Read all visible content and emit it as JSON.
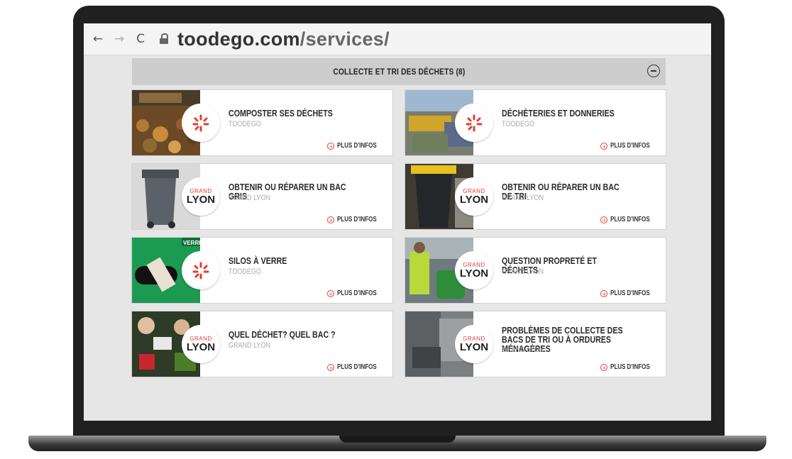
{
  "browser": {
    "url_domain": "toodego.com",
    "url_path": "/services/",
    "back_icon": "arrow-left",
    "forward_icon": "arrow-right",
    "reload_icon": "reload"
  },
  "section": {
    "title": "COLLECTE ET TRI DES DÉCHETS (8)",
    "collapse_icon": "minus-circle"
  },
  "cards": [
    {
      "title": "COMPOSTER SES DÉCHETS",
      "subtitle": "TOODEGO",
      "logo": "toodego",
      "more": "PLUS D'INFOS",
      "image": "compost"
    },
    {
      "title": "DÉCHÈTERIES ET DONNERIES",
      "subtitle": "TOODEGO",
      "logo": "toodego",
      "more": "PLUS D'INFOS",
      "image": "decheterie"
    },
    {
      "title": "OBTENIR OU RÉPARER UN BAC GRIS",
      "subtitle": "GRAND LYON",
      "logo": "grand-lyon",
      "more": "PLUS D'INFOS",
      "image": "grey-bin"
    },
    {
      "title": "OBTENIR OU RÉPARER UN BAC DE TRI",
      "subtitle": "GRAND LYON",
      "logo": "grand-lyon",
      "more": "PLUS D'INFOS",
      "image": "yellow-bin"
    },
    {
      "title": "SILOS À VERRE",
      "subtitle": "TOODEGO",
      "logo": "toodego",
      "more": "PLUS D'INFOS",
      "image": "glass-silo",
      "image_text": "VERRE"
    },
    {
      "title": "QUESTION PROPRETÉ ET DÉCHETS",
      "subtitle": "GRAND LYON",
      "logo": "grand-lyon",
      "more": "PLUS D'INFOS",
      "image": "street-cleaning"
    },
    {
      "title": "QUEL DÉCHET? QUEL BAC ?",
      "subtitle": "GRAND LYON",
      "logo": "grand-lyon",
      "more": "PLUS D'INFOS",
      "image": "sorting"
    },
    {
      "title": "PROBLÈMES DE COLLECTE DES BACS DE TRI OU À ORDURES MÉNAGÈRES",
      "subtitle": "GRAND LYON",
      "logo": "grand-lyon",
      "more": "PLUS D'INFOS",
      "image": "collection-truck"
    }
  ],
  "logos": {
    "grand_lyon_top": "GRAND",
    "grand_lyon_main": "LYON"
  },
  "colors": {
    "accent_red": "#e63c2f",
    "header_bg": "#cdcdcd",
    "subtitle_grey": "#aaaaaa"
  }
}
